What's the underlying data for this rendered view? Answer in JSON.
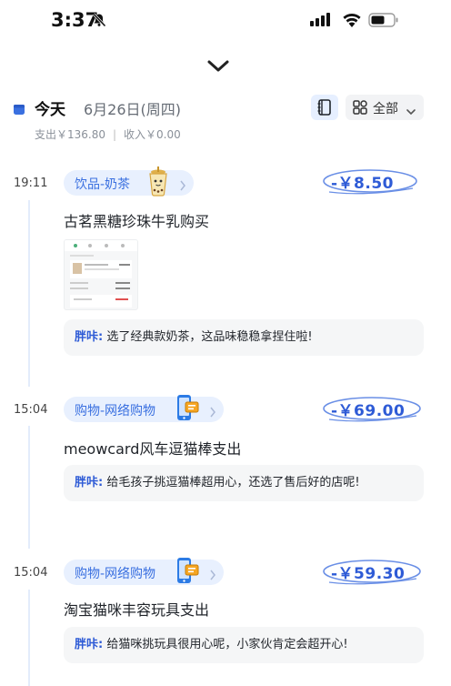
{
  "status_bar": {
    "time": "3:37"
  },
  "header": {
    "today_label": "今天",
    "date": "6月26日(周四)",
    "filter_label": "全部",
    "expense_summary": "支出￥136.80",
    "income_summary": "收入￥0.00",
    "summary_separator": "|"
  },
  "colors": {
    "accent": "#2e5bd6",
    "category_bg": "#e8f0fe",
    "note_bg": "#f5f6f7"
  },
  "records": [
    {
      "time": "19:11",
      "category": "饮品-奶茶",
      "category_icon": "milk-tea-icon",
      "amount": "-￥8.50",
      "title": "古茗黑糖珍珠牛乳购买",
      "has_receipt_image": true,
      "note_author": "胖咔:",
      "note_text": "选了经典款奶茶，这品味稳稳拿捏住啦!"
    },
    {
      "time": "15:04",
      "category": "购物-网络购物",
      "category_icon": "online-shopping-icon",
      "amount": "-￥69.00",
      "title": "meowcard风车逗猫棒支出",
      "has_receipt_image": false,
      "note_author": "胖咔:",
      "note_text": "给毛孩子挑逗猫棒超用心，还选了售后好的店呢!"
    },
    {
      "time": "15:04",
      "category": "购物-网络购物",
      "category_icon": "online-shopping-icon",
      "amount": "-￥59.30",
      "title": "淘宝猫咪丰容玩具支出",
      "has_receipt_image": false,
      "note_author": "胖咔:",
      "note_text": "给猫咪挑玩具很用心呢，小家伙肯定会超开心!"
    }
  ]
}
